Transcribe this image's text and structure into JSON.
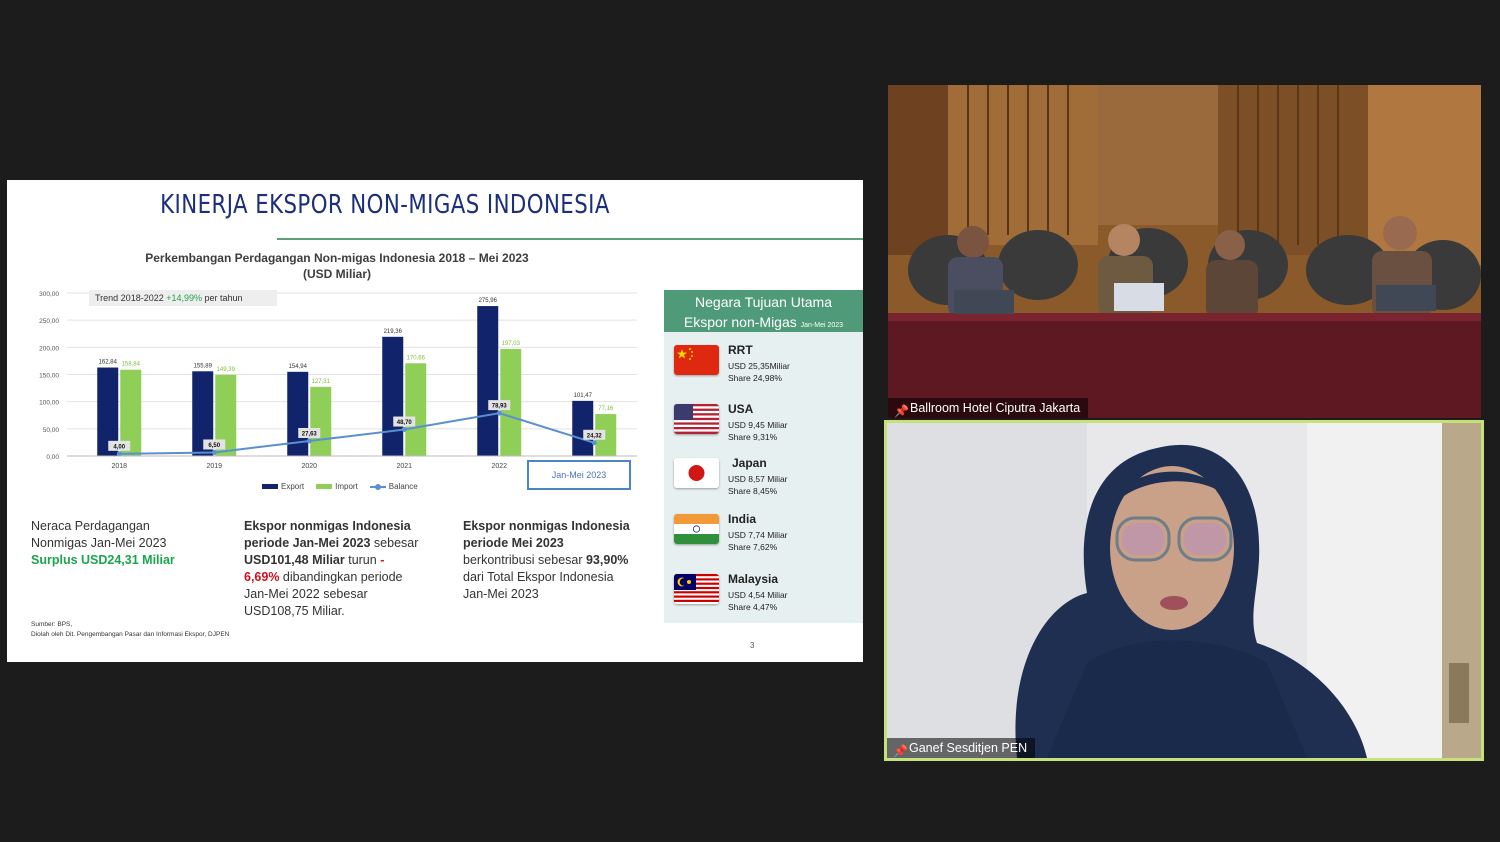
{
  "slide": {
    "title": "KINERJA EKSPOR NON-MIGAS INDONESIA",
    "chart_title_line1": "Perkembangan Perdagangan Non-migas Indonesia 2018 – Mei 2023",
    "chart_title_line2": "(USD Miliar)",
    "trend_label": "Trend 2018-2022",
    "trend_value": "+14,99%",
    "trend_suffix": "per tahun",
    "jan_mei_label": "Jan-Mei 2023",
    "legend": {
      "export": "Export",
      "import": "Import",
      "balance": "Balance"
    },
    "summary1": {
      "line1": "Neraca Perdagangan",
      "line2": "Nonmigas Jan-Mei 2023",
      "line3": "Surplus USD24,31 Miliar"
    },
    "summary2": {
      "l1": "Ekspor nonmigas Indonesia",
      "l2a": "periode Jan-Mei 2023",
      "l2b": " sebesar",
      "l3a": "USD101,48 Miliar",
      "l3b": " turun ",
      "l3c": "-",
      "l4a": "6,69%",
      "l4b": " dibandingkan periode",
      "l5": "Jan-Mei 2022 sebesar",
      "l6": "USD108,75 Miliar."
    },
    "summary3": {
      "l1": "Ekspor nonmigas Indonesia",
      "l2": "periode Mei 2023",
      "l3a": "berkontribusi sebesar ",
      "l3b": "93,90%",
      "l4": "dari Total Ekspor Indonesia",
      "l5": "Jan-Mei 2023"
    },
    "source_line1": "Sumber: BPS,",
    "source_line2": "Diolah oleh Dit. Pengembangan Pasar dan Informasi Ekspor, DJPEN",
    "page_number": "3",
    "side_title1": "Negara Tujuan Utama",
    "side_title2": "Ekspor non-Migas",
    "side_title_small": "Jan-Mei 2023",
    "countries": [
      {
        "name": "RRT",
        "value": "USD 25,35Miliar",
        "share": "Share 24,98%",
        "flag": "china-flag-icon"
      },
      {
        "name": "USA",
        "value": "USD 9,45 Miliar",
        "share": "Share 9,31%",
        "flag": "usa-flag-icon"
      },
      {
        "name": "Japan",
        "value": "USD 8,57 Miliar",
        "share": "Share 8,45%",
        "flag": "japan-flag-icon"
      },
      {
        "name": "India",
        "value": "USD 7,74 Miliar",
        "share": "Share 7,62%",
        "flag": "india-flag-icon"
      },
      {
        "name": "Malaysia",
        "value": "USD 4,54 Miliar",
        "share": "Share 4,47%",
        "flag": "malaysia-flag-icon"
      }
    ]
  },
  "chart_data": {
    "type": "bar",
    "categories": [
      "2018",
      "2019",
      "2020",
      "2021",
      "2022",
      ""
    ],
    "series": [
      {
        "name": "Export",
        "type": "bar",
        "color": "#10236b",
        "values": [
          162.84,
          155.89,
          154.94,
          219.36,
          275.96,
          101.47
        ],
        "labels": [
          "162,84",
          "155,89",
          "154,94",
          "219,36",
          "275,96",
          "101,47"
        ]
      },
      {
        "name": "Import",
        "type": "bar",
        "color": "#8fcf57",
        "values": [
          158.84,
          149.39,
          127.31,
          170.66,
          197.03,
          77.16
        ],
        "labels": [
          "158,84",
          "149,39",
          "127,31",
          "170,66",
          "197,03",
          "77,16"
        ]
      },
      {
        "name": "Balance",
        "type": "line",
        "color": "#5b8fd0",
        "values": [
          4.0,
          6.5,
          27.63,
          48.7,
          78.93,
          24.32
        ],
        "labels": [
          "4,00",
          "6,50",
          "27,63",
          "48,70",
          "78,93",
          "24,32"
        ]
      }
    ],
    "yticks": [
      "0,00",
      "50,00",
      "100,00",
      "150,00",
      "200,00",
      "250,00",
      "300,00"
    ],
    "ylim": [
      0,
      300
    ],
    "grid": true,
    "legend": "bottom"
  },
  "participants": [
    {
      "label": "Ballroom Hotel Ciputra Jakarta"
    },
    {
      "label": "Ganef Sesditjen PEN"
    }
  ],
  "colors": {
    "accent_green": "#4f9a78",
    "navy": "#1b2f7a",
    "speaker_border": "#c6e07a"
  }
}
